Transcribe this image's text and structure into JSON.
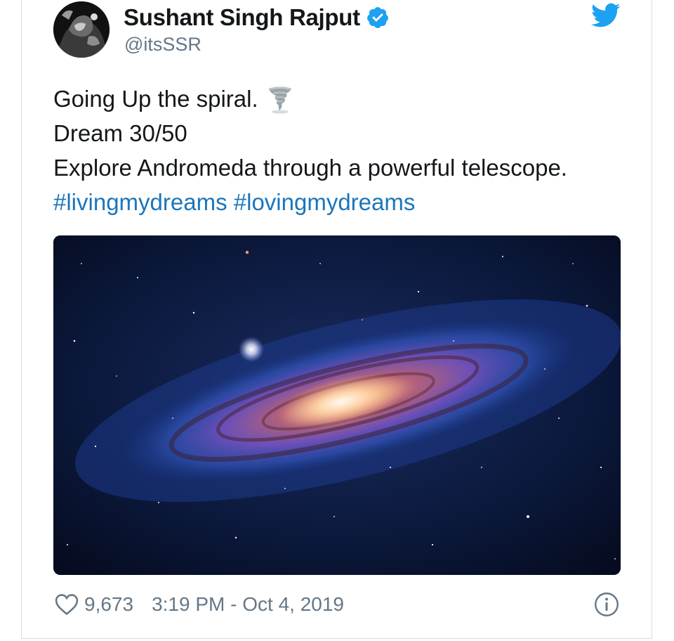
{
  "tweet": {
    "author_name": "Sushant Singh Rajput",
    "handle": "@itsSSR",
    "verified": true,
    "lines": [
      "Going Up the spiral.",
      "Dream 30/50",
      "Explore Andromeda through a powerful telescope."
    ],
    "emoji": "tornado-emoji",
    "hashtags": [
      "#livingmydreams",
      "#lovingmydreams"
    ],
    "likes": "9,673",
    "timestamp": "3:19 PM - Oct 4, 2019"
  },
  "colors": {
    "link": "#1b76bb",
    "twitter_blue": "#1da1f2",
    "text": "#14171a",
    "muted": "#657786"
  },
  "icons": {
    "brand": "twitter-bird-icon",
    "verified": "verified-badge-icon",
    "like": "heart-icon",
    "info": "info-icon"
  }
}
